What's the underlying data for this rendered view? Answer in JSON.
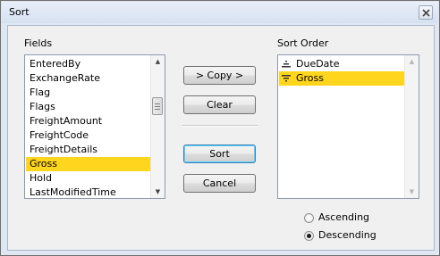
{
  "window": {
    "title": "Sort"
  },
  "fields": {
    "label": "Fields",
    "items": [
      {
        "text": "EnteredBy",
        "selected": false
      },
      {
        "text": "ExchangeRate",
        "selected": false
      },
      {
        "text": "Flag",
        "selected": false
      },
      {
        "text": "Flags",
        "selected": false
      },
      {
        "text": "FreightAmount",
        "selected": false
      },
      {
        "text": "FreightCode",
        "selected": false
      },
      {
        "text": "FreightDetails",
        "selected": false
      },
      {
        "text": "Gross",
        "selected": true
      },
      {
        "text": "Hold",
        "selected": false
      },
      {
        "text": "LastModifiedTime",
        "selected": false
      }
    ]
  },
  "sort_order": {
    "label": "Sort Order",
    "items": [
      {
        "text": "DueDate",
        "direction": "ascending",
        "icon": "sort-ascending-icon",
        "selected": false
      },
      {
        "text": "Gross",
        "direction": "descending",
        "icon": "sort-descending-icon",
        "selected": true
      }
    ]
  },
  "buttons": {
    "copy": "> Copy >",
    "clear": "Clear",
    "sort": "Sort",
    "cancel": "Cancel"
  },
  "direction": {
    "ascending_label": "Ascending",
    "descending_label": "Descending",
    "selected": "descending"
  },
  "colors": {
    "selection": "#ffd51d",
    "window_frame": "#dfe7f3"
  }
}
